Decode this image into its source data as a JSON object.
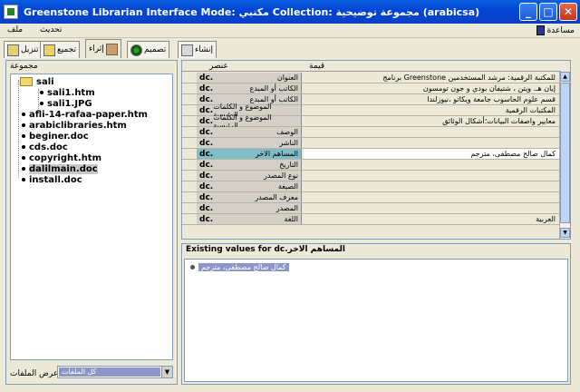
{
  "window": {
    "title": "Greenstone Librarian Interface  Mode: مكتبي  Collection: مجموعة توضيحية (arabicsa)",
    "buttons": [
      "_",
      "□",
      "✕"
    ]
  },
  "menu": {
    "file": "ملف",
    "update": "تحديث",
    "help": "مساعدة"
  },
  "tabs": [
    {
      "label": "تنزيل"
    },
    {
      "label": "تجميع"
    },
    {
      "label": "إثراء"
    },
    {
      "label": "تصميم"
    },
    {
      "label": "إنشاء"
    }
  ],
  "left_panel": {
    "title": "مجموعة",
    "tree": [
      {
        "label": "sali",
        "type": "folder"
      },
      {
        "label": "sali1.htm",
        "type": "file"
      },
      {
        "label": "sali1.JPG",
        "type": "file"
      },
      {
        "label": "afli-14-rafaa-paper.htm",
        "type": "file"
      },
      {
        "label": "arabiclibraries.htm",
        "type": "file"
      },
      {
        "label": "beginer.doc",
        "type": "file"
      },
      {
        "label": "cds.doc",
        "type": "file"
      },
      {
        "label": "copyright.htm",
        "type": "file"
      },
      {
        "label": "dalilmain.doc",
        "type": "file",
        "selected": true
      },
      {
        "label": "install.doc",
        "type": "file"
      }
    ],
    "filter_label": "عرض الملفات",
    "filter_value": "كل الملفات"
  },
  "metadata_table": {
    "col_element": "عنصر",
    "col_value": "قيمة",
    "rows": [
      {
        "dc": "dc.",
        "name": "العنوان",
        "value": "برنامج Greenstone للمكتبة الرقمية: مرشد المستخدمين"
      },
      {
        "dc": "dc.",
        "name": "الكاتب أو المبدع",
        "value": "إيان هـ. ويتن ، شتيفان بودي و جون تومسون"
      },
      {
        "dc": "dc.",
        "name": "الكاتب أو المبدع",
        "value": "قسم علوم الحاسوب جامعة ويكاتو ،نيوزلندا"
      },
      {
        "dc": "dc.",
        "name": "الموضوع و الكلمات الرئيسية",
        "value": "المكتبات الرقمية"
      },
      {
        "dc": "dc.",
        "name": "الموضوع و الكلمات الرئيسية",
        "value": "معايير واصفات البيانات؛أشكال الوثائق"
      },
      {
        "dc": "dc.",
        "name": "الوصف",
        "value": ""
      },
      {
        "dc": "dc.",
        "name": "الناشر",
        "value": ""
      },
      {
        "dc": "dc.",
        "name": "المساهم الاخر",
        "value": "كمال صالح مصطفى، مترجم",
        "selected": true
      },
      {
        "dc": "dc.",
        "name": "التاريخ",
        "value": ""
      },
      {
        "dc": "dc.",
        "name": "نوع المصدر",
        "value": ""
      },
      {
        "dc": "dc.",
        "name": "الصيغة",
        "value": ""
      },
      {
        "dc": "dc.",
        "name": "معرف المصدر",
        "value": ""
      },
      {
        "dc": "dc.",
        "name": "المصدر",
        "value": ""
      },
      {
        "dc": "dc.",
        "name": "اللغة",
        "value": "العربية"
      }
    ]
  },
  "existing_values": {
    "title": "Existing values for dc.المساهم الاخر",
    "items": [
      "كمال صالح مصطفى، مترجم"
    ]
  }
}
